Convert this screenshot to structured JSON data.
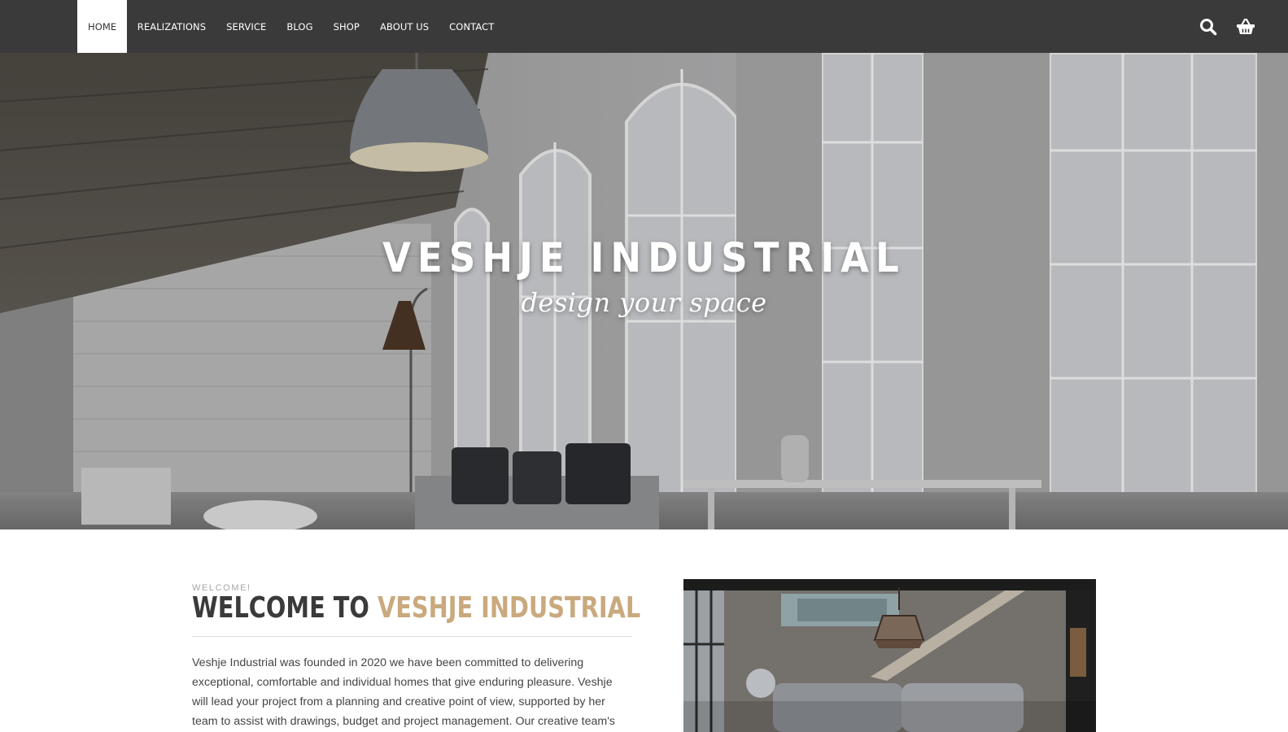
{
  "nav": {
    "items": [
      {
        "label": "HOME",
        "active": true
      },
      {
        "label": "REALIZATIONS",
        "active": false
      },
      {
        "label": "SERVICE",
        "active": false
      },
      {
        "label": "BLOG",
        "active": false
      },
      {
        "label": "SHOP",
        "active": false
      },
      {
        "label": "ABOUT US",
        "active": false
      },
      {
        "label": "CONTACT",
        "active": false
      }
    ],
    "icons": [
      "search-icon",
      "basket-icon"
    ]
  },
  "hero": {
    "title": "VESHJE INDUSTRIAL",
    "tagline": "design your space"
  },
  "welcome": {
    "eyebrow": "WELCOME!",
    "heading_prefix": "WELCOME TO",
    "heading_accent": "VESHJE INDUSTRIAL",
    "body": "Veshje Industrial was founded in 2020 we have been committed to delivering exceptional, comfortable and individual homes that give enduring pleasure. Veshje will lead your project from a planning and creative point of view, supported by her team to assist with drawings, budget and project management. Our creative team's attention to"
  },
  "colors": {
    "nav_bg": "#3a3a3a",
    "accent": "#c9a97e",
    "heading": "#3a3a3a"
  }
}
